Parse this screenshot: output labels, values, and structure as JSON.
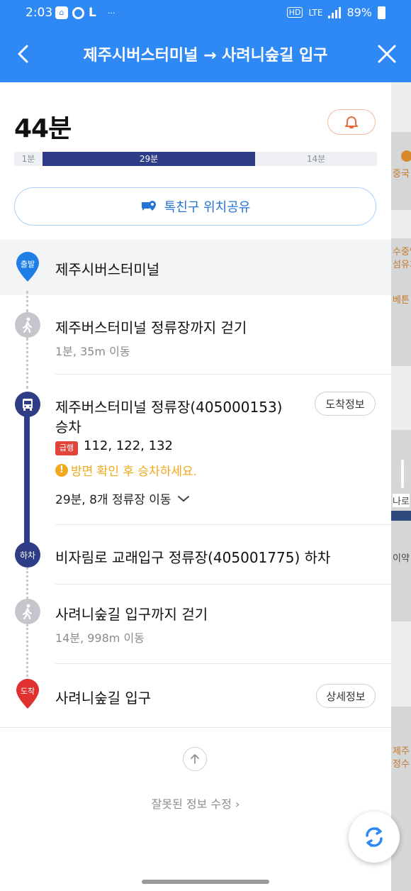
{
  "status_bar": {
    "time": "2:03",
    "icons": [
      "app-notification-icon",
      "ring-icon",
      "line-app-icon",
      "more-dots-icon"
    ],
    "network": "LTE",
    "battery": "89%"
  },
  "nav": {
    "title": "제주시버스터미널 → 사려니숲길 입구",
    "back_icon": "chevron-left-icon",
    "close_icon": "close-icon"
  },
  "summary": {
    "total_time": "44분",
    "alarm_icon": "bell-icon",
    "segments": [
      {
        "label": "1분",
        "minutes": 1,
        "type": "walk"
      },
      {
        "label": "29분",
        "minutes": 29,
        "type": "bus"
      },
      {
        "label": "14분",
        "minutes": 14,
        "type": "walk"
      }
    ],
    "share_label": "톡친구 위치공유"
  },
  "steps": {
    "start": {
      "badge": "출발",
      "label": "제주시버스터미널"
    },
    "walk1": {
      "label": "제주버스터미널 정류장까지 걷기",
      "sub": "1분, 35m 이동"
    },
    "bus": {
      "label_line1": "제주버스터미널 정류장(405000153)",
      "label_line2": "승차",
      "arrival_button": "도착정보",
      "express_badge": "급행",
      "routes": "112, 122, 132",
      "warning": "방면 확인 후 승차하세요.",
      "ride_info": "29분, 8개 정류장 이동"
    },
    "alight": {
      "badge": "하차",
      "label": "비자림로 교래입구 정류장(405001775) 하차"
    },
    "walk2": {
      "label": "사려니숲길 입구까지 걷기",
      "sub": "14분, 998m 이동"
    },
    "end": {
      "badge": "도착",
      "label": "사려니숲길 입구",
      "detail_button": "상세정보"
    }
  },
  "footer": {
    "report_link": "잘못된 정보 수정 ›"
  },
  "map": {
    "labels": [
      "중국",
      "수중앙",
      "섬유치",
      "베튼",
      "나로",
      "이약",
      "제주",
      "정수"
    ]
  },
  "colors": {
    "brand_blue": "#2f89f5",
    "bus_navy": "#2e3d86",
    "start_pin": "#1f7de6",
    "end_pin": "#e03131",
    "warning": "#f0a81c",
    "express": "#e1453a"
  }
}
